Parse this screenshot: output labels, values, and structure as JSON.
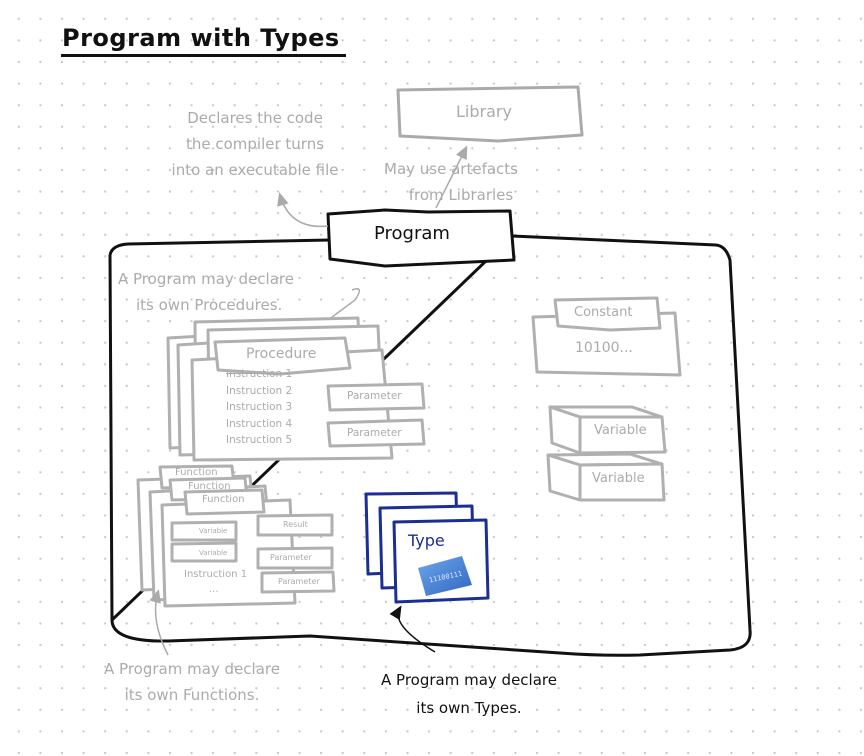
{
  "title": "Program with Types",
  "colors": {
    "ink": "#111111",
    "muted": "#aaaaaa",
    "type_accent": "#1a2f8f",
    "chip_blue": "#4a86d8"
  },
  "nodes": {
    "library": "Library",
    "program": "Program",
    "procedure": {
      "label": "Procedure",
      "instructions": [
        "Instruction 1",
        "Instruction 2",
        "Instruction 3",
        "Instruction 4",
        "Instruction 5",
        "..."
      ],
      "parameters": [
        "Parameter",
        "Parameter"
      ]
    },
    "constant": {
      "label": "Constant",
      "value": "10100..."
    },
    "variables": [
      "Variable",
      "Variable"
    ],
    "function": {
      "labels": [
        "Function",
        "Function",
        "Function"
      ],
      "variables": [
        "Variable",
        "Variable"
      ],
      "result": "Result",
      "parameters": [
        "Parameter",
        "Parameter"
      ],
      "instructions": [
        "Instruction 1",
        "..."
      ]
    },
    "type": {
      "label": "Type",
      "chip_text": "11100111"
    }
  },
  "annotations": {
    "program_desc": [
      "Declares the code",
      "the compiler turns",
      "into an executable file"
    ],
    "library_use": [
      "May use artefacts",
      "from Libraries"
    ],
    "procedures": [
      "A Program may declare",
      "its own Procedures."
    ],
    "functions": [
      "A Program may declare",
      "its own Functions."
    ],
    "types": [
      "A Program may declare",
      "its own Types."
    ]
  }
}
